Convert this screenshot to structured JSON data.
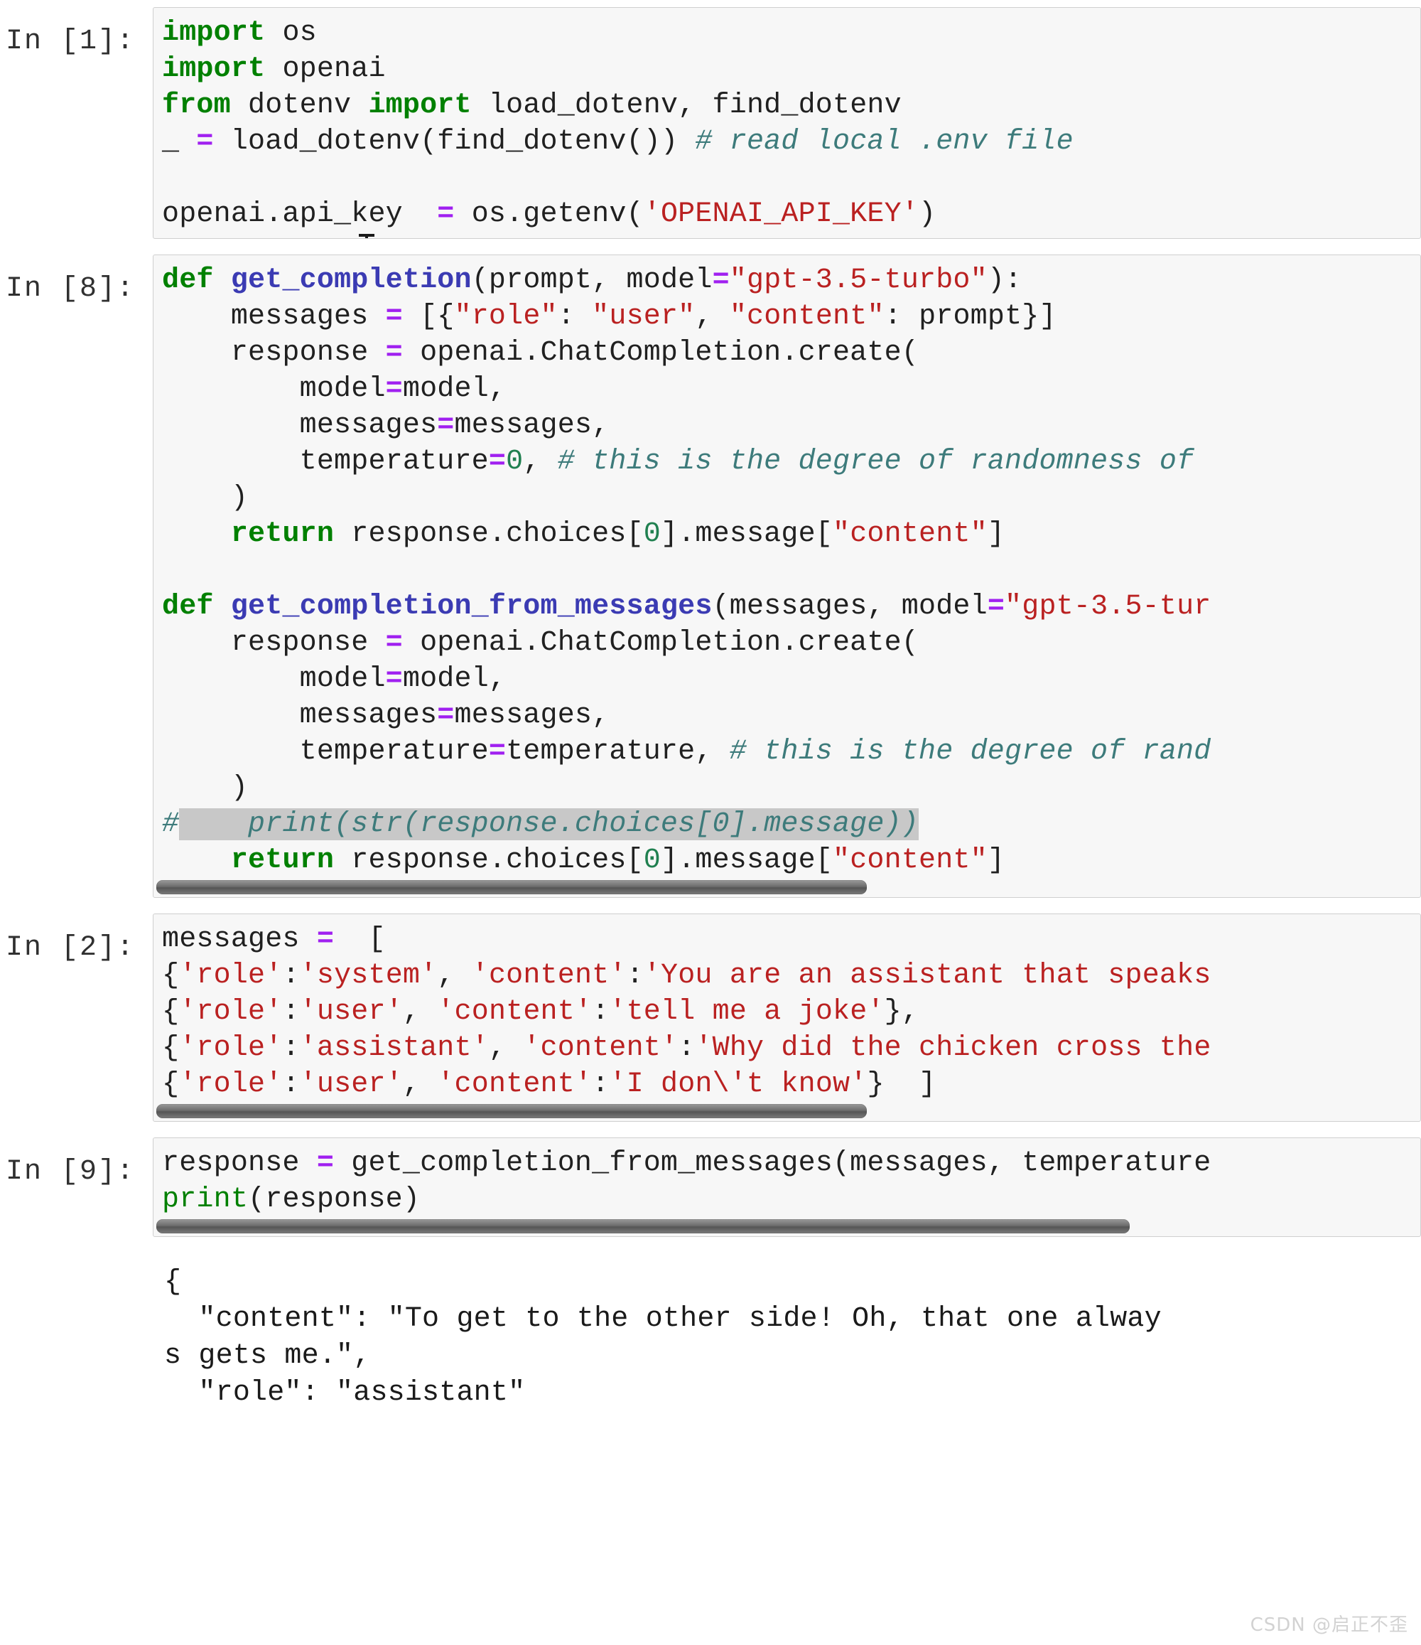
{
  "notebook": {
    "watermark": "CSDN @启正不歪"
  },
  "cells": [
    {
      "prompt": "In [1]:",
      "type": "code",
      "lines": [
        [
          {
            "t": "import",
            "c": "k"
          },
          {
            "t": " os",
            "c": "n"
          }
        ],
        [
          {
            "t": "import",
            "c": "k"
          },
          {
            "t": " openai",
            "c": "n"
          }
        ],
        [
          {
            "t": "from",
            "c": "k"
          },
          {
            "t": " dotenv ",
            "c": "n"
          },
          {
            "t": "import",
            "c": "k"
          },
          {
            "t": " load_dotenv, find_dotenv",
            "c": "n"
          }
        ],
        [
          {
            "t": "_ ",
            "c": "n"
          },
          {
            "t": "=",
            "c": "o"
          },
          {
            "t": " load_dotenv(find_dotenv()) ",
            "c": "n"
          },
          {
            "t": "# read local .env file",
            "c": "c"
          }
        ],
        [
          {
            "t": "",
            "c": "n"
          }
        ],
        [
          {
            "t": "openai.api_key  ",
            "c": "n"
          },
          {
            "t": "=",
            "c": "o"
          },
          {
            "t": " os.getenv(",
            "c": "n"
          },
          {
            "t": "'OPENAI_API_KEY'",
            "c": "s"
          },
          {
            "t": ")",
            "c": "n"
          }
        ]
      ]
    },
    {
      "prompt": "In [8]:",
      "type": "code",
      "scrollbar": true,
      "lines": [
        [
          {
            "t": "def",
            "c": "k"
          },
          {
            "t": " ",
            "c": "n"
          },
          {
            "t": "get_completion",
            "c": "nf"
          },
          {
            "t": "(prompt, model",
            "c": "n"
          },
          {
            "t": "=",
            "c": "o"
          },
          {
            "t": "\"gpt-3.5-turbo\"",
            "c": "s"
          },
          {
            "t": "):",
            "c": "n"
          }
        ],
        [
          {
            "t": "    messages ",
            "c": "n"
          },
          {
            "t": "=",
            "c": "o"
          },
          {
            "t": " [{",
            "c": "n"
          },
          {
            "t": "\"role\"",
            "c": "s"
          },
          {
            "t": ": ",
            "c": "n"
          },
          {
            "t": "\"user\"",
            "c": "s"
          },
          {
            "t": ", ",
            "c": "n"
          },
          {
            "t": "\"content\"",
            "c": "s"
          },
          {
            "t": ": prompt}]",
            "c": "n"
          }
        ],
        [
          {
            "t": "    response ",
            "c": "n"
          },
          {
            "t": "=",
            "c": "o"
          },
          {
            "t": " openai.ChatCompletion.create(",
            "c": "n"
          }
        ],
        [
          {
            "t": "        model",
            "c": "n"
          },
          {
            "t": "=",
            "c": "o"
          },
          {
            "t": "model,",
            "c": "n"
          }
        ],
        [
          {
            "t": "        messages",
            "c": "n"
          },
          {
            "t": "=",
            "c": "o"
          },
          {
            "t": "messages,",
            "c": "n"
          }
        ],
        [
          {
            "t": "        temperature",
            "c": "n"
          },
          {
            "t": "=",
            "c": "o"
          },
          {
            "t": "0",
            "c": "mi"
          },
          {
            "t": ", ",
            "c": "n"
          },
          {
            "t": "# this is the degree of randomness of",
            "c": "c"
          }
        ],
        [
          {
            "t": "    )",
            "c": "n"
          }
        ],
        [
          {
            "t": "    ",
            "c": "n"
          },
          {
            "t": "return",
            "c": "k"
          },
          {
            "t": " response.choices[",
            "c": "n"
          },
          {
            "t": "0",
            "c": "mi"
          },
          {
            "t": "].message[",
            "c": "n"
          },
          {
            "t": "\"content\"",
            "c": "s"
          },
          {
            "t": "]",
            "c": "n"
          }
        ],
        [
          {
            "t": "",
            "c": "n"
          }
        ],
        [
          {
            "t": "def",
            "c": "k"
          },
          {
            "t": " ",
            "c": "n"
          },
          {
            "t": "get_completion_from_messages",
            "c": "nf"
          },
          {
            "t": "(messages, model",
            "c": "n"
          },
          {
            "t": "=",
            "c": "o"
          },
          {
            "t": "\"gpt-3.5-tur",
            "c": "s"
          }
        ],
        [
          {
            "t": "    response ",
            "c": "n"
          },
          {
            "t": "=",
            "c": "o"
          },
          {
            "t": " openai.ChatCompletion.create(",
            "c": "n"
          }
        ],
        [
          {
            "t": "        model",
            "c": "n"
          },
          {
            "t": "=",
            "c": "o"
          },
          {
            "t": "model,",
            "c": "n"
          }
        ],
        [
          {
            "t": "        messages",
            "c": "n"
          },
          {
            "t": "=",
            "c": "o"
          },
          {
            "t": "messages,",
            "c": "n"
          }
        ],
        [
          {
            "t": "        temperature",
            "c": "n"
          },
          {
            "t": "=",
            "c": "o"
          },
          {
            "t": "temperature, ",
            "c": "n"
          },
          {
            "t": "# this is the degree of rand",
            "c": "c"
          }
        ],
        [
          {
            "t": "    )",
            "c": "n"
          }
        ],
        [
          {
            "t": "#",
            "c": "c"
          },
          {
            "t": "    print(str(response.choices[0].message))",
            "c": "c",
            "sel": true
          }
        ],
        [
          {
            "t": "    ",
            "c": "n"
          },
          {
            "t": "return",
            "c": "k"
          },
          {
            "t": " response.choices[",
            "c": "n"
          },
          {
            "t": "0",
            "c": "mi"
          },
          {
            "t": "].message[",
            "c": "n"
          },
          {
            "t": "\"content\"",
            "c": "s"
          },
          {
            "t": "]",
            "c": "n"
          }
        ]
      ]
    },
    {
      "prompt": "In [2]:",
      "type": "code",
      "scrollbar": true,
      "lines": [
        [
          {
            "t": "messages ",
            "c": "n"
          },
          {
            "t": "=",
            "c": "o"
          },
          {
            "t": "  [",
            "c": "n"
          }
        ],
        [
          {
            "t": "{",
            "c": "n"
          },
          {
            "t": "'role'",
            "c": "s"
          },
          {
            "t": ":",
            "c": "n"
          },
          {
            "t": "'system'",
            "c": "s"
          },
          {
            "t": ", ",
            "c": "n"
          },
          {
            "t": "'content'",
            "c": "s"
          },
          {
            "t": ":",
            "c": "n"
          },
          {
            "t": "'You are an assistant that speaks",
            "c": "s"
          }
        ],
        [
          {
            "t": "{",
            "c": "n"
          },
          {
            "t": "'role'",
            "c": "s"
          },
          {
            "t": ":",
            "c": "n"
          },
          {
            "t": "'user'",
            "c": "s"
          },
          {
            "t": ", ",
            "c": "n"
          },
          {
            "t": "'content'",
            "c": "s"
          },
          {
            "t": ":",
            "c": "n"
          },
          {
            "t": "'tell me a joke'",
            "c": "s"
          },
          {
            "t": "},",
            "c": "n"
          }
        ],
        [
          {
            "t": "{",
            "c": "n"
          },
          {
            "t": "'role'",
            "c": "s"
          },
          {
            "t": ":",
            "c": "n"
          },
          {
            "t": "'assistant'",
            "c": "s"
          },
          {
            "t": ", ",
            "c": "n"
          },
          {
            "t": "'content'",
            "c": "s"
          },
          {
            "t": ":",
            "c": "n"
          },
          {
            "t": "'Why did the chicken cross the",
            "c": "s"
          }
        ],
        [
          {
            "t": "{",
            "c": "n"
          },
          {
            "t": "'role'",
            "c": "s"
          },
          {
            "t": ":",
            "c": "n"
          },
          {
            "t": "'user'",
            "c": "s"
          },
          {
            "t": ", ",
            "c": "n"
          },
          {
            "t": "'content'",
            "c": "s"
          },
          {
            "t": ":",
            "c": "n"
          },
          {
            "t": "'I don\\'t know'",
            "c": "s"
          },
          {
            "t": "}  ]",
            "c": "n"
          }
        ]
      ]
    },
    {
      "prompt": "In [9]:",
      "type": "code",
      "scrollbar": true,
      "lines": [
        [
          {
            "t": "response ",
            "c": "n"
          },
          {
            "t": "=",
            "c": "o"
          },
          {
            "t": " get_completion_from_messages(messages, temperature",
            "c": "n"
          }
        ],
        [
          {
            "t": "print",
            "c": "bn"
          },
          {
            "t": "(response)",
            "c": "n"
          }
        ]
      ]
    },
    {
      "prompt": "",
      "type": "output",
      "text": "{\n  \"content\": \"To get to the other side! Oh, that one alway\ns gets me.\",\n  \"role\": \"assistant\""
    }
  ]
}
